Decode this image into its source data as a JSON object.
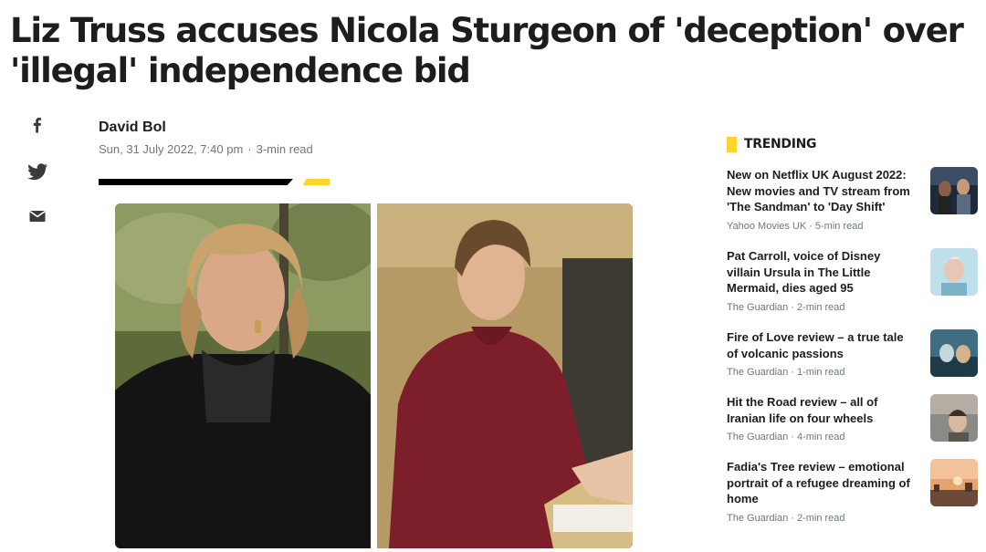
{
  "article": {
    "headline": "Liz Truss accuses Nicola Sturgeon of 'deception' over 'illegal' independence bid",
    "author": "David Bol",
    "date": "Sun, 31 July 2022, 7:40 pm",
    "separator": "·",
    "read_time": "3-min read"
  },
  "share": [
    {
      "name": "facebook-icon"
    },
    {
      "name": "twitter-icon"
    },
    {
      "name": "email-icon"
    }
  ],
  "trending": {
    "title": "TRENDING",
    "accent": "#fcd42c",
    "items": [
      {
        "title": "New on Netflix UK August 2022: New movies and TV stream from 'The Sandman' to 'Day Shift'",
        "source": "Yahoo Movies UK",
        "sep": "·",
        "read": "5-min read"
      },
      {
        "title": "Pat Carroll, voice of Disney villain Ursula in The Little Mermaid, dies aged 95",
        "source": "The Guardian",
        "sep": "·",
        "read": "2-min read"
      },
      {
        "title": "Fire of Love review – a true tale of volcanic passions",
        "source": "The Guardian",
        "sep": "·",
        "read": "1-min read"
      },
      {
        "title": "Hit the Road review – all of Iranian life on four wheels",
        "source": "The Guardian",
        "sep": "·",
        "read": "4-min read"
      },
      {
        "title": "Fadia's Tree review – emotional portrait of a refugee dreaming of home",
        "source": "The Guardian",
        "sep": "·",
        "read": "2-min read"
      }
    ]
  }
}
